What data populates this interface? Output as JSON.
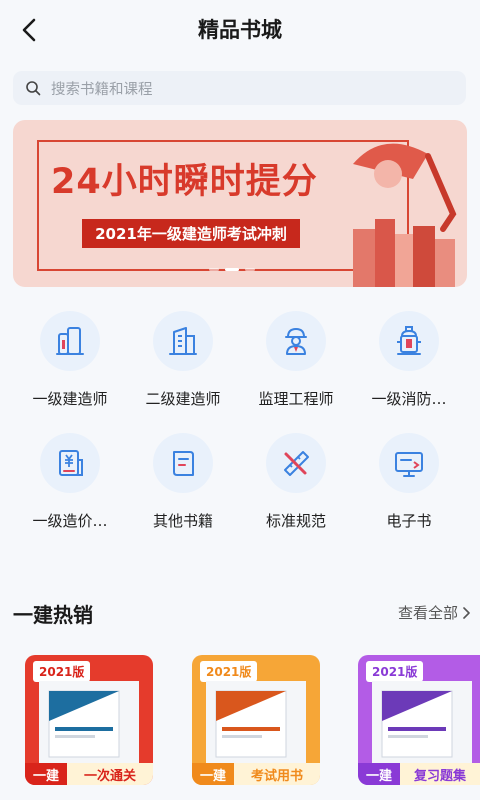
{
  "header": {
    "title": "精品书城",
    "back_icon": "chevron-left-icon"
  },
  "search": {
    "placeholder": "搜索书籍和课程",
    "icon": "search-icon"
  },
  "banner": {
    "headline": "24小时瞬时提分",
    "subtitle": "2021年一级建造师考试冲刺",
    "slides": 3,
    "active_slide": 1
  },
  "categories": [
    {
      "label": "一级建造师",
      "icon": "buildings-icon"
    },
    {
      "label": "二级建造师",
      "icon": "office-building-icon"
    },
    {
      "label": "监理工程师",
      "icon": "engineer-icon"
    },
    {
      "label": "一级消防…",
      "icon": "fire-hydrant-icon"
    },
    {
      "label": "一级造价…",
      "icon": "cost-document-icon"
    },
    {
      "label": "其他书籍",
      "icon": "book-icon"
    },
    {
      "label": "标准规范",
      "icon": "ruler-pencil-icon"
    },
    {
      "label": "电子书",
      "icon": "monitor-icon"
    }
  ],
  "hot_section": {
    "title": "一建热销",
    "view_all": "查看全部"
  },
  "books": [
    {
      "edition": "2021版",
      "tag_a": "一建",
      "tag_b": "一次通关",
      "accent": "#d9241b",
      "bg": "#e53b2c"
    },
    {
      "edition": "2021版",
      "tag_a": "一建",
      "tag_b": "考试用书",
      "accent": "#f08a1c",
      "bg": "#f6a637"
    },
    {
      "edition": "2021版",
      "tag_a": "一建",
      "tag_b": "复习题集",
      "accent": "#8a3ad6",
      "bg": "#b35ce6"
    }
  ],
  "colors": {
    "accent_blue": "#3b82e0",
    "banner_red": "#d83a2b",
    "page_bg": "#f6f8fb"
  }
}
